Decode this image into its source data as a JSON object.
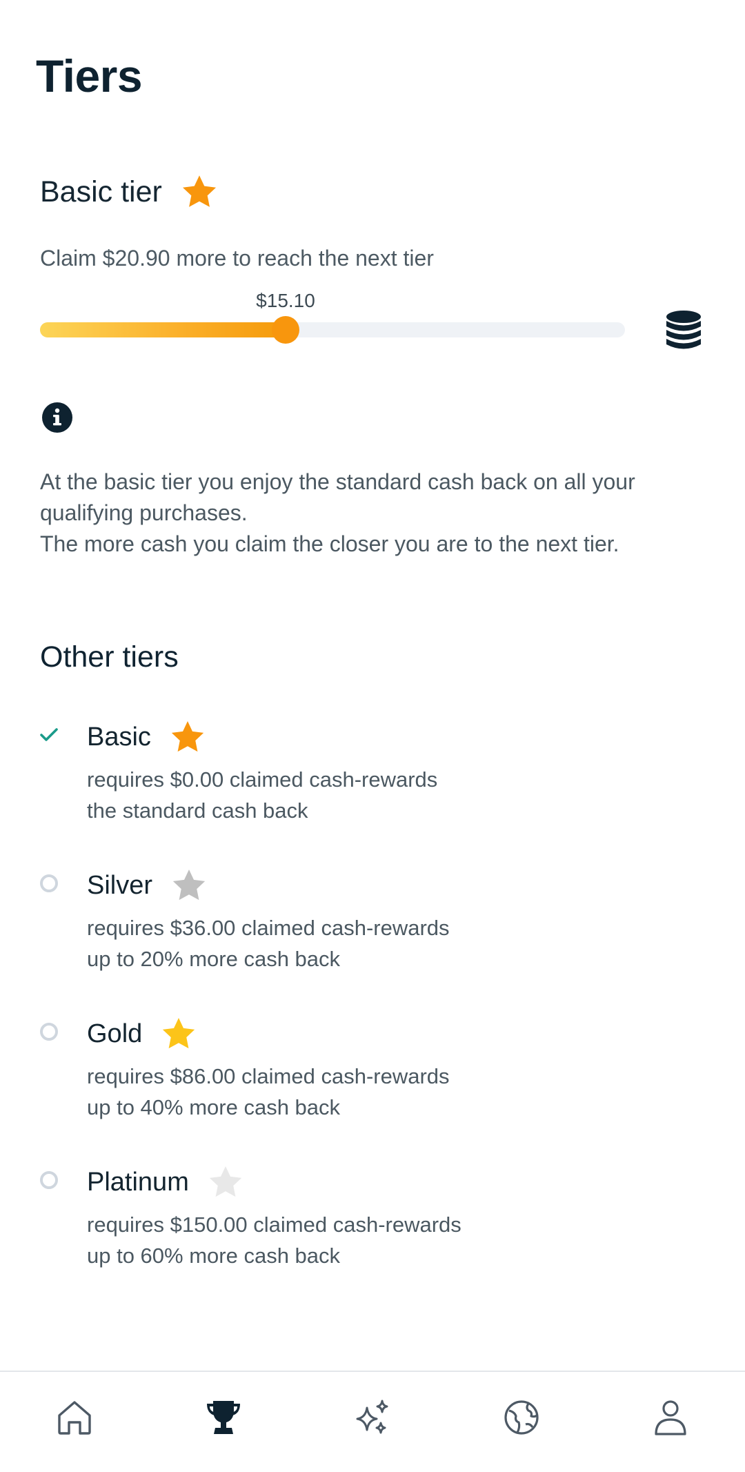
{
  "page": {
    "title": "Tiers"
  },
  "current_tier": {
    "name": "Basic tier",
    "star_color": "#f8960d",
    "claim_message": "Claim $20.90 more to reach the next tier",
    "progress_label": "$15.10",
    "progress_fraction": 0.42
  },
  "description": {
    "line1": "At the basic tier you enjoy the standard cash back on all your qualifying purchases.",
    "line2": "The more cash you claim the closer you are to the next tier."
  },
  "other_tiers": {
    "title": "Other tiers",
    "items": [
      {
        "name": "Basic",
        "star_color": "#f8960d",
        "status": "achieved",
        "requirement": "requires $0.00 claimed cash-rewards",
        "perk": "the standard cash back"
      },
      {
        "name": "Silver",
        "star_color": "#bfbfbf",
        "status": "locked",
        "requirement": "requires $36.00 claimed cash-rewards",
        "perk": "up to 20% more cash back"
      },
      {
        "name": "Gold",
        "star_color": "#fcc419",
        "status": "locked",
        "requirement": "requires $86.00 claimed cash-rewards",
        "perk": "up to 40% more cash back"
      },
      {
        "name": "Platinum",
        "star_color": "#e8e8e8",
        "status": "locked",
        "requirement": "requires $150.00 claimed cash-rewards",
        "perk": "up to 60% more cash back"
      }
    ]
  },
  "colors": {
    "accent": "#f8960d",
    "check": "#1a9b8a",
    "pending_circle": "#cfd6de",
    "text_dark": "#0e2230"
  },
  "bottom_nav": {
    "items": [
      {
        "icon": "home-icon",
        "active": false
      },
      {
        "icon": "trophy-icon",
        "active": true
      },
      {
        "icon": "sparkles-icon",
        "active": false
      },
      {
        "icon": "globe-icon",
        "active": false
      },
      {
        "icon": "profile-icon",
        "active": false
      }
    ]
  }
}
